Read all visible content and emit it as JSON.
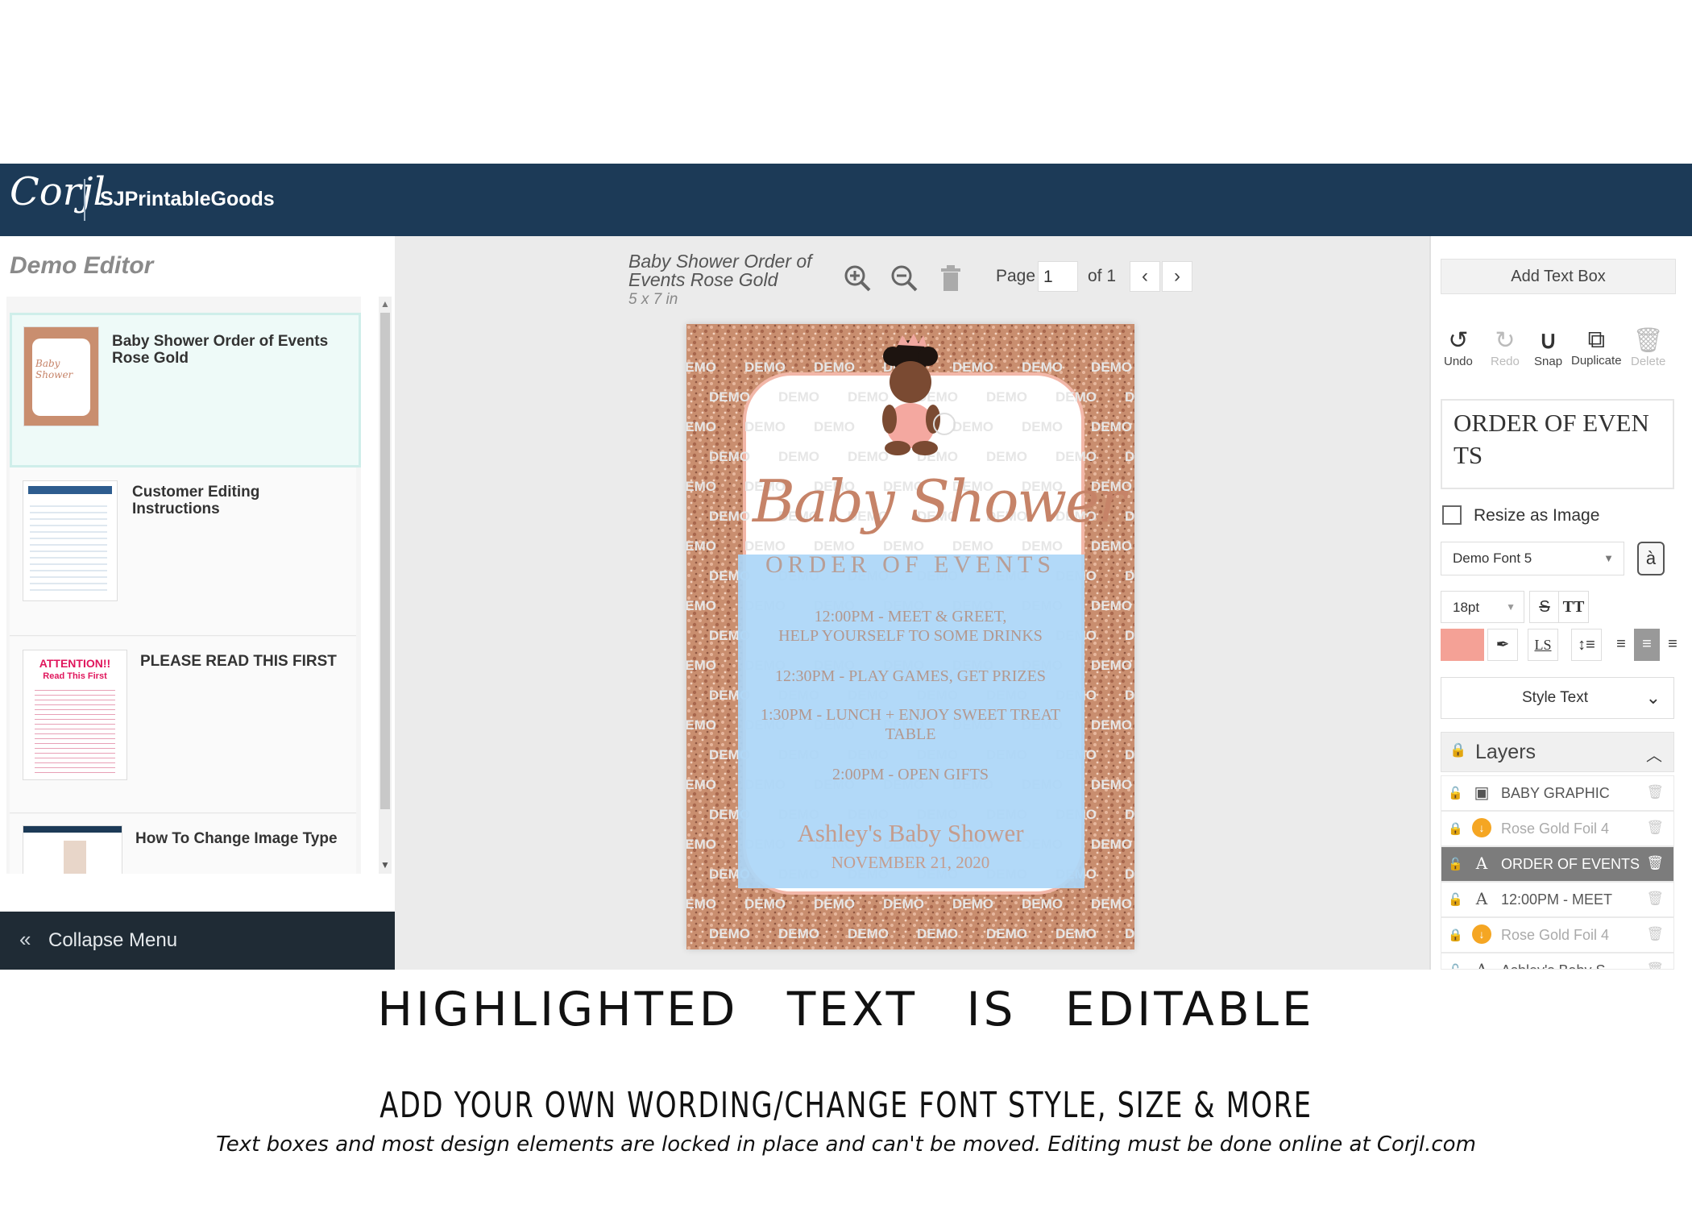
{
  "header": {
    "logo": "Corjl",
    "brand": "SJPrintableGoods"
  },
  "sidebar": {
    "title": "Demo Editor",
    "items": [
      {
        "label": "Baby Shower Order of Events Rose Gold",
        "thumb_text": "Baby Shower"
      },
      {
        "label": "Customer Editing Instructions"
      },
      {
        "label": "PLEASE READ THIS FIRST",
        "thumb_title": "ATTENTION!!",
        "thumb_subtitle": "Read This First"
      },
      {
        "label": "How To Change Image Type"
      }
    ],
    "collapse_label": "Collapse Menu"
  },
  "canvas": {
    "doc_title": "Baby Shower Order of Events Rose Gold",
    "doc_size": "5 x 7 in",
    "page_label": "Page",
    "page_value": "1",
    "page_of": "of 1",
    "invitation": {
      "watermark": "DEMO",
      "script_title": "Baby Shower",
      "heading": "ORDER OF EVENTS",
      "events": [
        {
          "line1": "12:00PM - MEET & GREET,",
          "line2": "HELP YOURSELF TO SOME DRINKS"
        },
        {
          "line1": "12:30PM - PLAY GAMES, GET PRIZES",
          "line2": ""
        },
        {
          "line1": "1:30PM - LUNCH + ENJOY SWEET TREAT",
          "line2": "TABLE"
        },
        {
          "line1": "2:00PM - OPEN GIFTS",
          "line2": ""
        }
      ],
      "host_line": "Ashley's Baby Shower",
      "date_line": "NOVEMBER 21, 2020"
    }
  },
  "right_panel": {
    "add_text_box": "Add Text Box",
    "tools": [
      {
        "icon": "undo-icon",
        "label": "Undo",
        "enabled": true
      },
      {
        "icon": "redo-icon",
        "label": "Redo",
        "enabled": false
      },
      {
        "icon": "snap-icon",
        "label": "Snap",
        "enabled": true
      },
      {
        "icon": "duplicate-icon",
        "label": "Duplicate",
        "enabled": true
      },
      {
        "icon": "trash-icon",
        "label": "Delete",
        "enabled": false
      }
    ],
    "text_value": "ORDER OF EVENTS",
    "resize_as_image": "Resize as Image",
    "font": "Demo Font 5",
    "font_size": "18pt",
    "color": "#f4a196",
    "style_text": "Style Text",
    "layers_title": "Layers",
    "layers": [
      {
        "icon": "image-icon",
        "name": "BABY GRAPHIC",
        "locked": false,
        "selected": false
      },
      {
        "icon": "foil-icon",
        "name": "Rose Gold Foil 4",
        "locked": true,
        "selected": false
      },
      {
        "icon": "text-icon",
        "name": "ORDER OF EVENTS",
        "locked": false,
        "selected": true
      },
      {
        "icon": "text-icon",
        "name": "12:00PM - MEET",
        "locked": false,
        "selected": false
      },
      {
        "icon": "foil-icon",
        "name": "Rose Gold Foil 4",
        "locked": true,
        "selected": false
      },
      {
        "icon": "text-icon",
        "name": "Ashley's Baby S",
        "locked": false,
        "selected": false
      }
    ]
  },
  "captions": {
    "line1": "HIGHLIGHTED TEXT IS EDITABLE",
    "line2": "ADD YOUR OWN WORDING/CHANGE FONT STYLE, SIZE & MORE",
    "line3": "Text boxes and most design elements are locked in place and can't be moved. Editing must be done online at Corjl.com"
  }
}
